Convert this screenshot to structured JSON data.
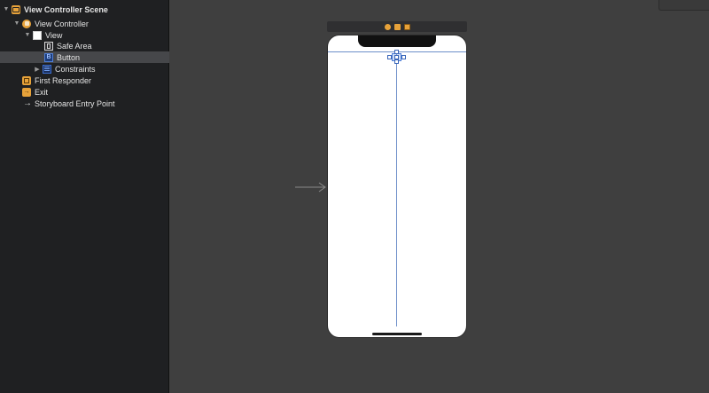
{
  "outline": {
    "items": [
      {
        "label": "View Controller Scene",
        "icon": "scene-icon",
        "disclosure": "expanded"
      },
      {
        "label": "View Controller",
        "icon": "view-controller-icon",
        "disclosure": "expanded"
      },
      {
        "label": "View",
        "icon": "view-icon",
        "disclosure": "expanded"
      },
      {
        "label": "Safe Area",
        "icon": "safe-area-icon",
        "disclosure": "none"
      },
      {
        "label": "Button",
        "icon": "button-icon",
        "disclosure": "none",
        "selected": true
      },
      {
        "label": "Constraints",
        "icon": "constraints-icon",
        "disclosure": "collapsed"
      },
      {
        "label": "First Responder",
        "icon": "first-responder-icon",
        "disclosure": "none"
      },
      {
        "label": "Exit",
        "icon": "exit-icon",
        "disclosure": "none"
      },
      {
        "label": "Storyboard Entry Point",
        "icon": "entry-point-arrow-icon",
        "disclosure": "none"
      }
    ],
    "button_icon_glyph": "B"
  },
  "canvas": {
    "scene_dock_icons": [
      "view-controller-icon",
      "first-responder-icon",
      "exit-icon"
    ]
  },
  "colors": {
    "accent": "#e7a23a",
    "selection": "#46474a",
    "constraint": "#6d8fc9"
  }
}
